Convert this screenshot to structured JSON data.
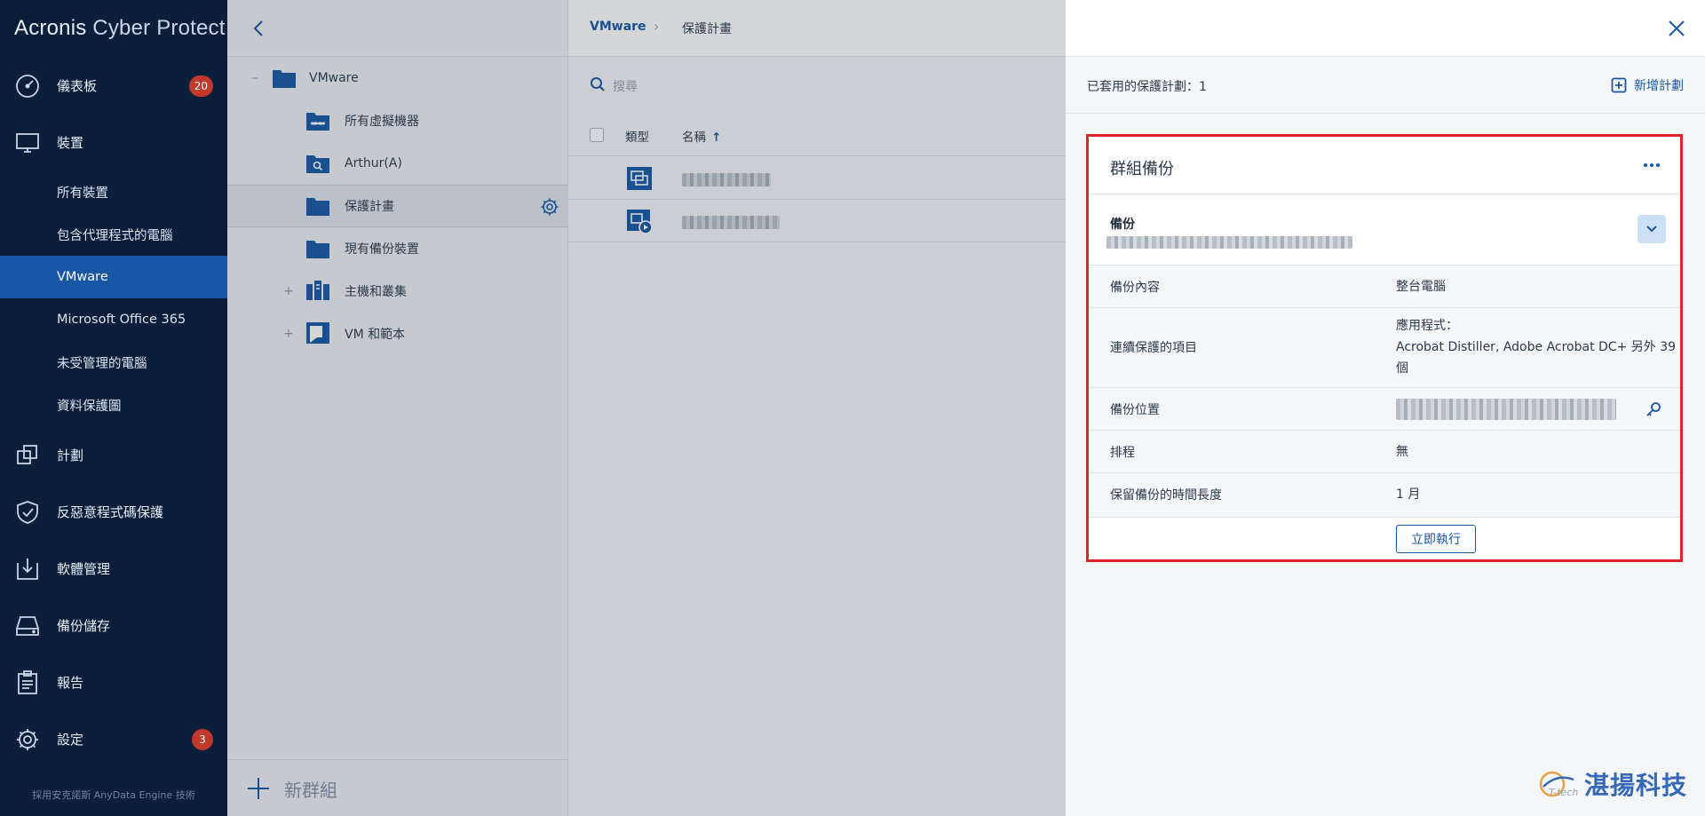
{
  "sidebar": {
    "brand_bold": "Acronis",
    "brand_light": " Cyber Protect",
    "main_items": [
      {
        "label": "儀表板",
        "icon": "dashboard-icon",
        "badge": "20"
      },
      {
        "label": "裝置",
        "icon": "monitor-icon"
      },
      {
        "label": "計劃",
        "icon": "plans-icon"
      },
      {
        "label": "反惡意程式碼保護",
        "icon": "shield-check-icon"
      },
      {
        "label": "軟體管理",
        "icon": "software-download-icon"
      },
      {
        "label": "備份儲存",
        "icon": "drive-icon"
      },
      {
        "label": "報告",
        "icon": "report-clipboard-icon"
      },
      {
        "label": "設定",
        "icon": "gear-icon",
        "badge": "3"
      }
    ],
    "device_subitems": [
      "所有裝置",
      "包含代理程式的電腦",
      "VMware",
      "Microsoft Office 365",
      "未受管理的電腦",
      "資料保護圖"
    ],
    "active_subitem": "VMware",
    "footer": "採用安克諾斯 AnyData Engine 技術"
  },
  "tree": {
    "items": [
      {
        "label": "VMware",
        "toggle": "–",
        "icon": "folder-icon"
      },
      {
        "label": "所有虛擬機器",
        "icon": "folder-infinity-icon"
      },
      {
        "label": "Arthur(A)",
        "icon": "folder-search-icon"
      },
      {
        "label": "保護計畫",
        "icon": "folder-icon",
        "selected": true
      },
      {
        "label": "現有備份裝置",
        "icon": "folder-icon"
      },
      {
        "label": "主機和叢集",
        "toggle": "+",
        "icon": "hosts-clusters-icon"
      },
      {
        "label": "VM 和範本",
        "toggle": "+",
        "icon": "vm-template-icon"
      }
    ],
    "new_group": "新群組"
  },
  "main": {
    "breadcrumb": [
      "VMware",
      "保護計畫"
    ],
    "breadcrumb_sep": "›",
    "search_placeholder": "搜尋",
    "columns": {
      "type": "類型",
      "name": "名稱",
      "sort_arrow": "↑"
    },
    "rows": [
      {
        "name_hidden": "██████████",
        "icon": "vm-icon"
      },
      {
        "name_hidden": "███████████",
        "icon": "vm-running-icon"
      }
    ]
  },
  "panel": {
    "applied_label": "已套用的保護計劃：1",
    "new_plan_label": "新增計劃",
    "card": {
      "title": "群組備份",
      "backup_title": "備份",
      "backup_subtitle_hidden": "██████████████████████████████",
      "details": [
        {
          "key": "備份內容",
          "value": "整台電腦"
        },
        {
          "key": "連續保護的項目",
          "value_line1": "應用程式：",
          "value_line2": "Acrobat Distiller, Adobe Acrobat DC+ 另外 39",
          "value_line3": "個"
        },
        {
          "key": "備份位置",
          "value_hidden": "███████████████████████"
        },
        {
          "key": "排程",
          "value": "無"
        },
        {
          "key": "保留備份的時間長度",
          "value": "1 月"
        }
      ],
      "run_now": "立即執行"
    },
    "watermark": "湛揚科技"
  },
  "colors": {
    "sidebar_bg": "#0b1f3b",
    "accent": "#1757a6",
    "highlight": "#e3232c",
    "badge": "#c0392b"
  }
}
